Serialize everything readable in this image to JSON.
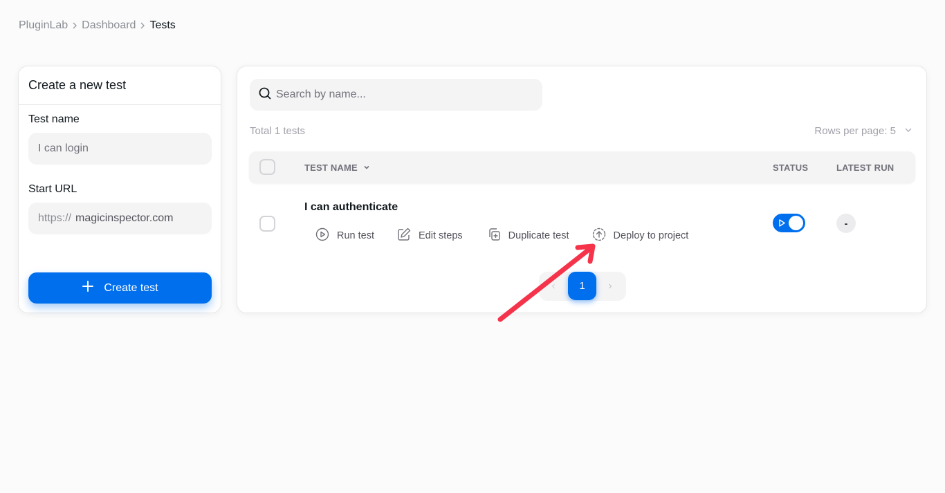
{
  "breadcrumb": {
    "items": [
      "PluginLab",
      "Dashboard",
      "Tests"
    ]
  },
  "create_card": {
    "title": "Create a new test",
    "test_name_label": "Test name",
    "test_name_placeholder": "I can login",
    "start_url_label": "Start URL",
    "start_url_prefix": "https://",
    "start_url_value": "magicinspector.com",
    "create_button_label": "Create test",
    "create_button_icon": "plus-icon"
  },
  "tests": {
    "search_placeholder": "Search by name...",
    "search_icon": "search-icon",
    "total_label": "Total 1 tests",
    "rows_per_page_label": "Rows per page:",
    "rows_per_page_value": "5",
    "columns": {
      "name": "TEST NAME",
      "status": "STATUS",
      "latest_run": "LATEST RUN"
    },
    "rows": [
      {
        "name": "I can authenticate",
        "actions": {
          "run": "Run test",
          "edit": "Edit steps",
          "duplicate": "Duplicate test",
          "deploy": "Deploy to project"
        },
        "status_enabled": true,
        "latest_run": "-"
      }
    ],
    "pagination": {
      "current_page": "1"
    }
  },
  "colors": {
    "primary": "#006fee",
    "annotation_arrow": "#f5334a",
    "background": "#fbfbfb"
  }
}
